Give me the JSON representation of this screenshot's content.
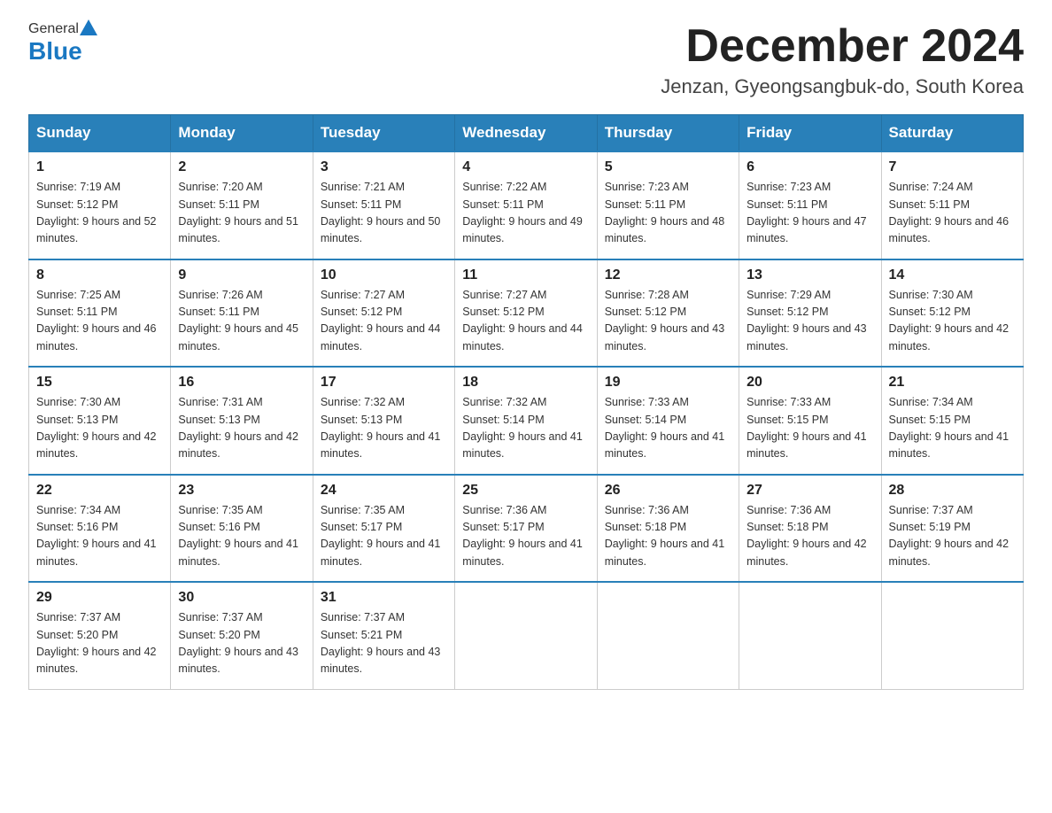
{
  "header": {
    "logo": {
      "general": "General",
      "blue": "Blue"
    },
    "title": "December 2024",
    "subtitle": "Jenzan, Gyeongsangbuk-do, South Korea"
  },
  "calendar": {
    "days": [
      "Sunday",
      "Monday",
      "Tuesday",
      "Wednesday",
      "Thursday",
      "Friday",
      "Saturday"
    ],
    "weeks": [
      [
        {
          "num": "1",
          "sunrise": "7:19 AM",
          "sunset": "5:12 PM",
          "daylight": "9 hours and 52 minutes."
        },
        {
          "num": "2",
          "sunrise": "7:20 AM",
          "sunset": "5:11 PM",
          "daylight": "9 hours and 51 minutes."
        },
        {
          "num": "3",
          "sunrise": "7:21 AM",
          "sunset": "5:11 PM",
          "daylight": "9 hours and 50 minutes."
        },
        {
          "num": "4",
          "sunrise": "7:22 AM",
          "sunset": "5:11 PM",
          "daylight": "9 hours and 49 minutes."
        },
        {
          "num": "5",
          "sunrise": "7:23 AM",
          "sunset": "5:11 PM",
          "daylight": "9 hours and 48 minutes."
        },
        {
          "num": "6",
          "sunrise": "7:23 AM",
          "sunset": "5:11 PM",
          "daylight": "9 hours and 47 minutes."
        },
        {
          "num": "7",
          "sunrise": "7:24 AM",
          "sunset": "5:11 PM",
          "daylight": "9 hours and 46 minutes."
        }
      ],
      [
        {
          "num": "8",
          "sunrise": "7:25 AM",
          "sunset": "5:11 PM",
          "daylight": "9 hours and 46 minutes."
        },
        {
          "num": "9",
          "sunrise": "7:26 AM",
          "sunset": "5:11 PM",
          "daylight": "9 hours and 45 minutes."
        },
        {
          "num": "10",
          "sunrise": "7:27 AM",
          "sunset": "5:12 PM",
          "daylight": "9 hours and 44 minutes."
        },
        {
          "num": "11",
          "sunrise": "7:27 AM",
          "sunset": "5:12 PM",
          "daylight": "9 hours and 44 minutes."
        },
        {
          "num": "12",
          "sunrise": "7:28 AM",
          "sunset": "5:12 PM",
          "daylight": "9 hours and 43 minutes."
        },
        {
          "num": "13",
          "sunrise": "7:29 AM",
          "sunset": "5:12 PM",
          "daylight": "9 hours and 43 minutes."
        },
        {
          "num": "14",
          "sunrise": "7:30 AM",
          "sunset": "5:12 PM",
          "daylight": "9 hours and 42 minutes."
        }
      ],
      [
        {
          "num": "15",
          "sunrise": "7:30 AM",
          "sunset": "5:13 PM",
          "daylight": "9 hours and 42 minutes."
        },
        {
          "num": "16",
          "sunrise": "7:31 AM",
          "sunset": "5:13 PM",
          "daylight": "9 hours and 42 minutes."
        },
        {
          "num": "17",
          "sunrise": "7:32 AM",
          "sunset": "5:13 PM",
          "daylight": "9 hours and 41 minutes."
        },
        {
          "num": "18",
          "sunrise": "7:32 AM",
          "sunset": "5:14 PM",
          "daylight": "9 hours and 41 minutes."
        },
        {
          "num": "19",
          "sunrise": "7:33 AM",
          "sunset": "5:14 PM",
          "daylight": "9 hours and 41 minutes."
        },
        {
          "num": "20",
          "sunrise": "7:33 AM",
          "sunset": "5:15 PM",
          "daylight": "9 hours and 41 minutes."
        },
        {
          "num": "21",
          "sunrise": "7:34 AM",
          "sunset": "5:15 PM",
          "daylight": "9 hours and 41 minutes."
        }
      ],
      [
        {
          "num": "22",
          "sunrise": "7:34 AM",
          "sunset": "5:16 PM",
          "daylight": "9 hours and 41 minutes."
        },
        {
          "num": "23",
          "sunrise": "7:35 AM",
          "sunset": "5:16 PM",
          "daylight": "9 hours and 41 minutes."
        },
        {
          "num": "24",
          "sunrise": "7:35 AM",
          "sunset": "5:17 PM",
          "daylight": "9 hours and 41 minutes."
        },
        {
          "num": "25",
          "sunrise": "7:36 AM",
          "sunset": "5:17 PM",
          "daylight": "9 hours and 41 minutes."
        },
        {
          "num": "26",
          "sunrise": "7:36 AM",
          "sunset": "5:18 PM",
          "daylight": "9 hours and 41 minutes."
        },
        {
          "num": "27",
          "sunrise": "7:36 AM",
          "sunset": "5:18 PM",
          "daylight": "9 hours and 42 minutes."
        },
        {
          "num": "28",
          "sunrise": "7:37 AM",
          "sunset": "5:19 PM",
          "daylight": "9 hours and 42 minutes."
        }
      ],
      [
        {
          "num": "29",
          "sunrise": "7:37 AM",
          "sunset": "5:20 PM",
          "daylight": "9 hours and 42 minutes."
        },
        {
          "num": "30",
          "sunrise": "7:37 AM",
          "sunset": "5:20 PM",
          "daylight": "9 hours and 43 minutes."
        },
        {
          "num": "31",
          "sunrise": "7:37 AM",
          "sunset": "5:21 PM",
          "daylight": "9 hours and 43 minutes."
        },
        null,
        null,
        null,
        null
      ]
    ]
  }
}
